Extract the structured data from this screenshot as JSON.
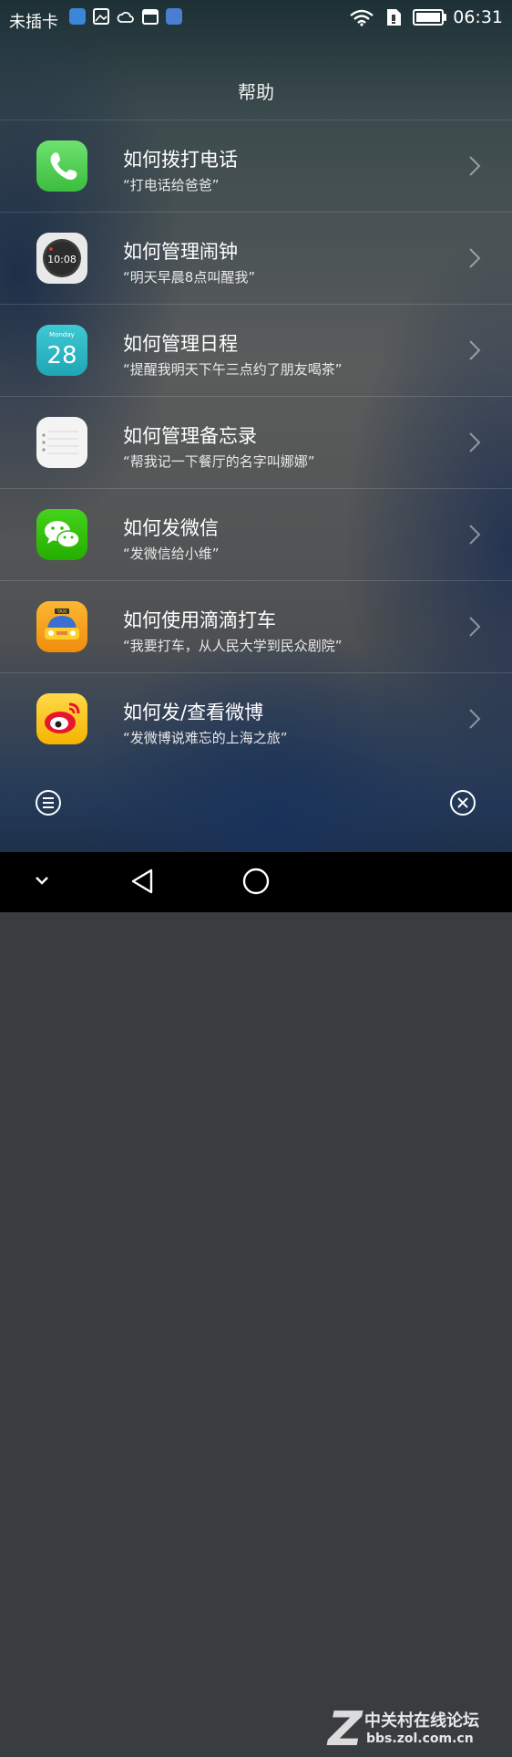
{
  "status_bar": {
    "carrier": "未插卡",
    "time": "06:31"
  },
  "header": {
    "title": "帮助"
  },
  "items": [
    {
      "title": "如何拨打电话",
      "subtitle": "“打电话给爸爸”",
      "icon": "phone-app-icon"
    },
    {
      "title": "如何管理闹钟",
      "subtitle": "“明天早晨8点叫醒我”",
      "icon": "clock-app-icon",
      "icon_text": "10:08"
    },
    {
      "title": "如何管理日程",
      "subtitle": "“提醒我明天下午三点约了朋友喝茶”",
      "icon": "calendar-app-icon",
      "icon_day": "Monday",
      "icon_date": "28"
    },
    {
      "title": "如何管理备忘录",
      "subtitle": "“帮我记一下餐厅的名字叫娜娜”",
      "icon": "notes-app-icon"
    },
    {
      "title": "如何发微信",
      "subtitle": "“发微信给小维”",
      "icon": "wechat-app-icon"
    },
    {
      "title": "如何使用滴滴打车",
      "subtitle": "“我要打车，从人民大学到民众剧院”",
      "icon": "didi-taxi-app-icon",
      "icon_text": "TAXI"
    },
    {
      "title": "如何发/查看微博",
      "subtitle": "“发微博说难忘的上海之旅”",
      "icon": "weibo-app-icon"
    }
  ],
  "watermark": {
    "brand": "中关村在线论坛",
    "url": "bbs.zol.com.cn",
    "logo_letter": "Z"
  },
  "colors": {
    "phone_green": "#4cd35a",
    "calendar_teal": "#2bb8c6",
    "wechat_green": "#2dc100",
    "didi_orange": "#f7a21b"
  }
}
